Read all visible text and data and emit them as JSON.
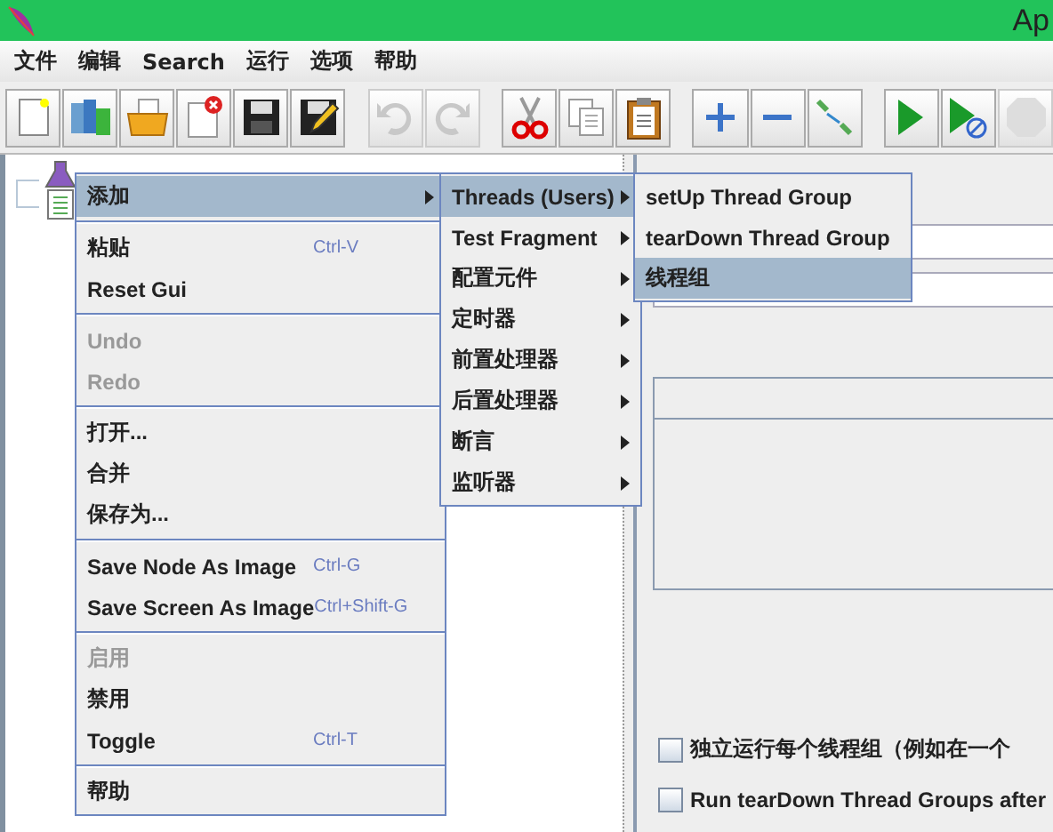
{
  "window": {
    "title": "Ap"
  },
  "menubar": [
    {
      "label": "文件"
    },
    {
      "label": "编辑"
    },
    {
      "label": "Search"
    },
    {
      "label": "运行"
    },
    {
      "label": "选项"
    },
    {
      "label": "帮助"
    }
  ],
  "toolbar": [
    {
      "kind": "new",
      "disabled": false
    },
    {
      "kind": "templates",
      "disabled": false
    },
    {
      "kind": "open",
      "disabled": false
    },
    {
      "kind": "close",
      "disabled": false
    },
    {
      "kind": "save",
      "disabled": false
    },
    {
      "kind": "saveas",
      "disabled": false
    },
    {
      "kind": "gap"
    },
    {
      "kind": "undo",
      "disabled": true
    },
    {
      "kind": "redo",
      "disabled": true
    },
    {
      "kind": "gap"
    },
    {
      "kind": "cut",
      "disabled": false
    },
    {
      "kind": "copy",
      "disabled": false
    },
    {
      "kind": "paste",
      "disabled": false
    },
    {
      "kind": "gap"
    },
    {
      "kind": "expand",
      "disabled": false
    },
    {
      "kind": "collapse",
      "disabled": false
    },
    {
      "kind": "toggle",
      "disabled": false
    },
    {
      "kind": "gap"
    },
    {
      "kind": "start",
      "disabled": false
    },
    {
      "kind": "start-no-pause",
      "disabled": false
    },
    {
      "kind": "stop",
      "disabled": true
    }
  ],
  "context_menu": [
    {
      "kind": "item",
      "label": "添加",
      "submenu": true,
      "selected": true,
      "disabled": false
    },
    {
      "kind": "separator"
    },
    {
      "kind": "item",
      "label": "粘贴",
      "shortcut": "Ctrl-V",
      "selected": false,
      "disabled": false
    },
    {
      "kind": "item",
      "label": "Reset Gui",
      "selected": false,
      "disabled": false
    },
    {
      "kind": "separator"
    },
    {
      "kind": "item",
      "label": "Undo",
      "selected": false,
      "disabled": true
    },
    {
      "kind": "item",
      "label": "Redo",
      "selected": false,
      "disabled": true
    },
    {
      "kind": "separator"
    },
    {
      "kind": "item",
      "label": "打开...",
      "selected": false,
      "disabled": false
    },
    {
      "kind": "item",
      "label": "合并",
      "selected": false,
      "disabled": false
    },
    {
      "kind": "item",
      "label": "保存为...",
      "selected": false,
      "disabled": false
    },
    {
      "kind": "separator"
    },
    {
      "kind": "item",
      "label": "Save Node As Image",
      "shortcut": "Ctrl-G",
      "selected": false,
      "disabled": false
    },
    {
      "kind": "item",
      "label": "Save Screen As Image",
      "shortcut": "Ctrl+Shift-G",
      "selected": false,
      "disabled": false
    },
    {
      "kind": "separator"
    },
    {
      "kind": "item",
      "label": "启用",
      "selected": false,
      "disabled": true
    },
    {
      "kind": "item",
      "label": "禁用",
      "selected": false,
      "disabled": false
    },
    {
      "kind": "item",
      "label": "Toggle",
      "shortcut": "Ctrl-T",
      "selected": false,
      "disabled": false
    },
    {
      "kind": "separator"
    },
    {
      "kind": "item",
      "label": "帮助",
      "selected": false,
      "disabled": false
    }
  ],
  "add_submenu": [
    {
      "label": "Threads (Users)",
      "submenu": true,
      "selected": true,
      "disabled": false
    },
    {
      "label": "Test Fragment",
      "submenu": true,
      "selected": false,
      "disabled": false
    },
    {
      "label": "配置元件",
      "submenu": true,
      "selected": false,
      "disabled": false
    },
    {
      "label": "定时器",
      "submenu": true,
      "selected": false,
      "disabled": false
    },
    {
      "label": "前置处理器",
      "submenu": true,
      "selected": false,
      "disabled": false
    },
    {
      "label": "后置处理器",
      "submenu": true,
      "selected": false,
      "disabled": false
    },
    {
      "label": "断言",
      "submenu": true,
      "selected": false,
      "disabled": false
    },
    {
      "label": "监听器",
      "submenu": true,
      "selected": false,
      "disabled": false
    }
  ],
  "threads_submenu": [
    {
      "label": "setUp Thread Group",
      "selected": false,
      "disabled": false
    },
    {
      "label": "tearDown Thread Group",
      "selected": false,
      "disabled": false
    },
    {
      "label": "线程组",
      "selected": true,
      "disabled": false
    }
  ],
  "checkboxes": [
    {
      "label": "独立运行每个线程组（例如在一个",
      "checked": false
    },
    {
      "label": "Run tearDown Thread Groups after",
      "checked": false
    }
  ]
}
